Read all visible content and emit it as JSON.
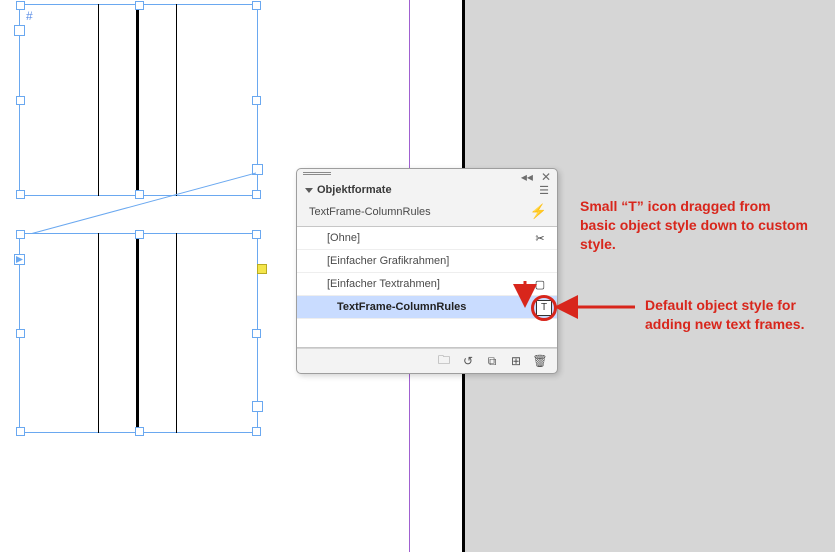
{
  "canvas": {
    "hash_marker": "#"
  },
  "panel": {
    "title": "Objektformate",
    "applied_style": "TextFrame-ColumnRules",
    "flyout_icon": "panel-menu",
    "collapse_icon": "collapse",
    "close_icon": "close",
    "quick_apply_icon": "lightning",
    "styles": [
      {
        "label": "[Ohne]",
        "marker": "none-marker"
      },
      {
        "label": "[Einfacher Grafikrahmen]",
        "marker": ""
      },
      {
        "label": "[Einfacher Textrahmen]",
        "marker": "frame-glyph"
      },
      {
        "label": "TextFrame-ColumnRules",
        "marker": "text-default-glyph",
        "selected": true
      }
    ],
    "footer": {
      "clear_override": "clear-overrides-icon",
      "folder": "folder-icon",
      "group": "group-icon",
      "new": "new-style-icon",
      "delete": "trash-icon"
    }
  },
  "annotations": {
    "top": "Small “T” icon dragged from basic object style down to custom style.",
    "right": "Default object style for adding new text frames."
  },
  "colors": {
    "accent_red": "#d8261c",
    "sel_blue": "#6aa8f0",
    "panel_bg": "#f3f3f3"
  }
}
